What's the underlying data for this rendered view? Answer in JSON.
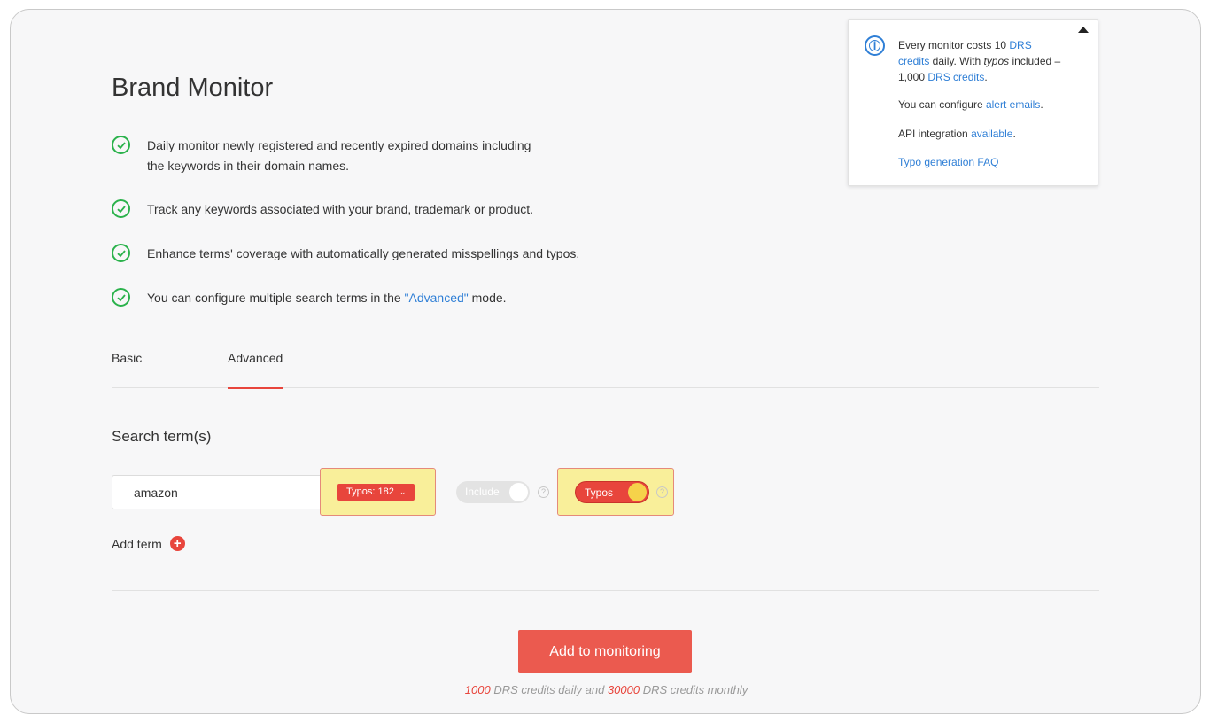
{
  "page": {
    "title": "Brand Monitor"
  },
  "features": [
    {
      "lines": [
        "Daily monitor newly registered and recently expired domains including",
        "the keywords in their domain names."
      ]
    },
    {
      "lines": [
        "Track any keywords associated with your brand, trademark or product."
      ]
    },
    {
      "lines": [
        "Enhance terms' coverage with automatically generated misspellings and typos."
      ]
    },
    {
      "before": "You can configure multiple search terms in the ",
      "link": "\"Advanced\"",
      "after": " mode."
    }
  ],
  "tabs": [
    {
      "label": "Basic",
      "active": false
    },
    {
      "label": "Advanced",
      "active": true
    }
  ],
  "search": {
    "section_title": "Search term(s)",
    "term_value": "amazon",
    "typos_badge": "Typos: 182",
    "include_toggle": "Include",
    "typos_toggle": "Typos",
    "help_glyph": "?",
    "add_term_label": "Add term"
  },
  "submit": {
    "label": "Add to monitoring",
    "daily_credits": "1000",
    "daily_text": " DRS credits daily and ",
    "monthly_credits": "30000",
    "monthly_text": " DRS credits monthly"
  },
  "info_panel": {
    "p1_a": "Every monitor costs 10 ",
    "p1_link1a": "DRS",
    "p1_link1b": "credits",
    "p1_b": " daily. With ",
    "p1_em": "typos",
    "p1_c": " included –",
    "p1_d": "1,000 ",
    "p1_link2": "DRS credits",
    "p1_e": ".",
    "p2_a": "You can configure ",
    "p2_link": "alert emails",
    "p2_b": ".",
    "p3_a": "API integration ",
    "p3_link": "available",
    "p3_b": ".",
    "p4_link": "Typo generation FAQ"
  },
  "colors": {
    "accent": "#e8453c",
    "link": "#2f7fd6",
    "check": "#2bb24c",
    "highlight": "#f9ef9a"
  }
}
